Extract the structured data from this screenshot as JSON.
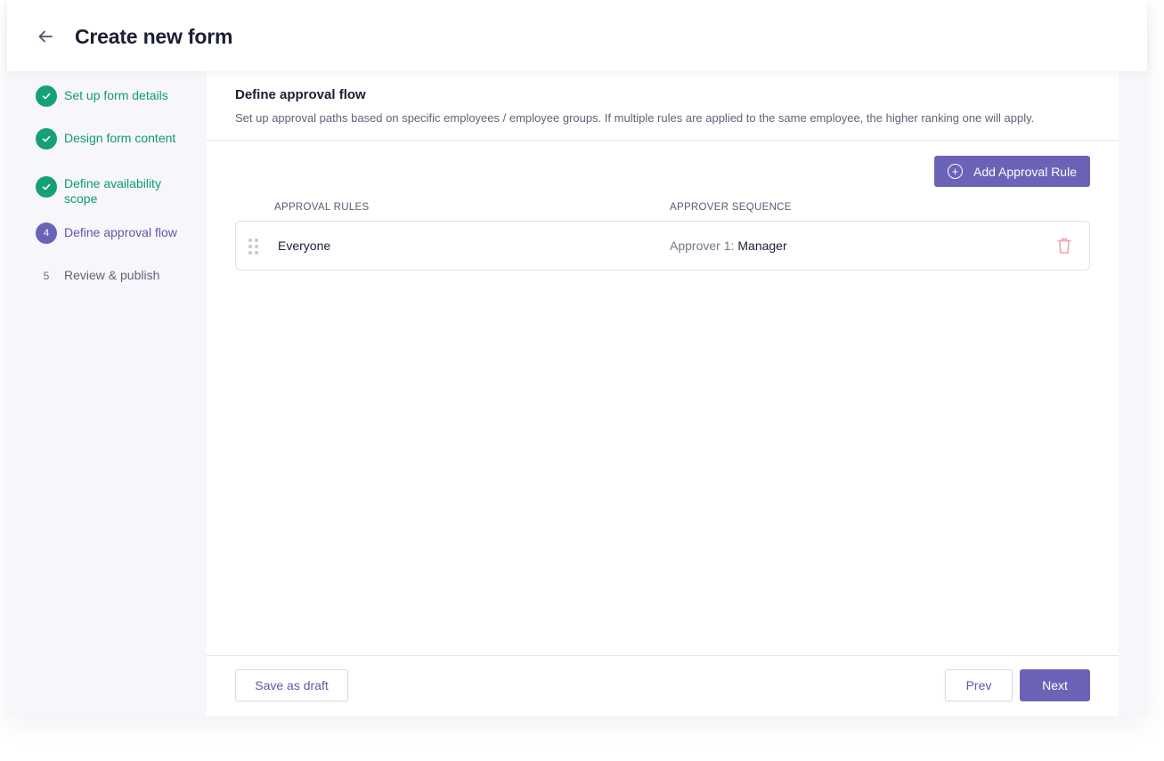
{
  "header": {
    "title": "Create new form"
  },
  "sidebar": {
    "steps": [
      {
        "number": "1",
        "label": "Set up form details",
        "state": "done"
      },
      {
        "number": "2",
        "label": "Design form content",
        "state": "done"
      },
      {
        "number": "3",
        "label": "Define availability scope",
        "state": "done"
      },
      {
        "number": "4",
        "label": "Define approval flow",
        "state": "active"
      },
      {
        "number": "5",
        "label": "Review & publish",
        "state": "pending"
      }
    ]
  },
  "main": {
    "title": "Define approval flow",
    "description": "Set up approval paths based on specific employees / employee groups. If multiple rules are applied to the same employee, the higher ranking one will apply.",
    "add_button_label": "Add Approval Rule",
    "columns": [
      "APPROVAL RULES",
      "APPROVER SEQUENCE"
    ],
    "rules": [
      {
        "name": "Everyone",
        "approver_key": "Approver 1:",
        "approver_value": "Manager"
      }
    ]
  },
  "footer": {
    "save_draft_label": "Save as draft",
    "prev_label": "Prev",
    "next_label": "Next"
  },
  "colors": {
    "accent": "#6b63b7",
    "success": "#15a175",
    "danger": "#f2a3a3"
  }
}
